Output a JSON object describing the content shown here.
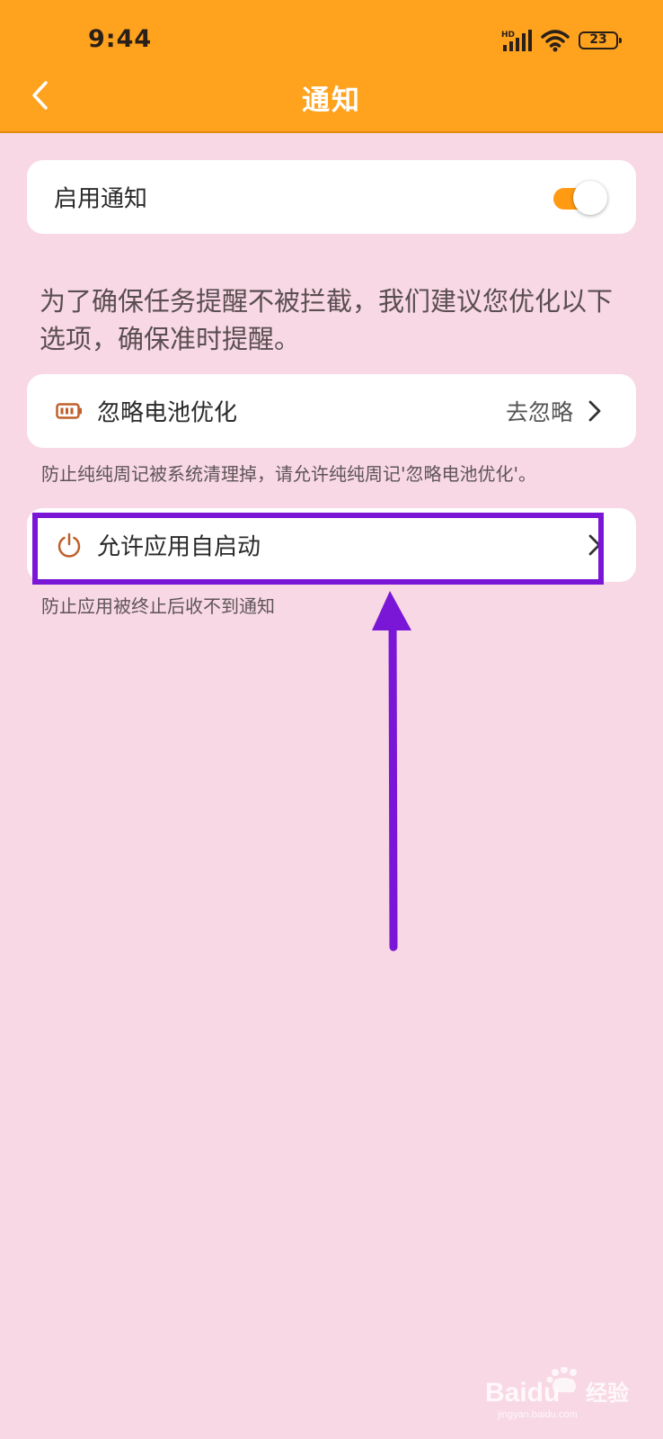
{
  "status_bar": {
    "time": "9:44",
    "battery": "23"
  },
  "header": {
    "title": "通知"
  },
  "enable_card": {
    "label": "启用通知",
    "toggle_on": true
  },
  "description": "为了确保任务提醒不被拦截，我们建议您优化以下选项，确保准时提醒。",
  "battery_card": {
    "label": "忽略电池优化",
    "action": "去忽略",
    "hint": "防止纯纯周记被系统清理掉，请允许纯纯周记'忽略电池优化'。"
  },
  "autostart_card": {
    "label": "允许应用自启动",
    "hint": "防止应用被终止后收不到通知"
  },
  "watermark": {
    "brand": "Baidu",
    "text": "经验",
    "url": "jingyan.baidu.com"
  },
  "colors": {
    "header": "#ffa21e",
    "background": "#f8d8e4",
    "accent": "#ff9a12",
    "icon": "#c0602a",
    "annotation": "#7a16d6"
  },
  "icons": {
    "back": "back-chevron-icon",
    "battery_item": "battery-icon",
    "autostart_item": "power-icon",
    "chevron": "chevron-right-icon"
  }
}
